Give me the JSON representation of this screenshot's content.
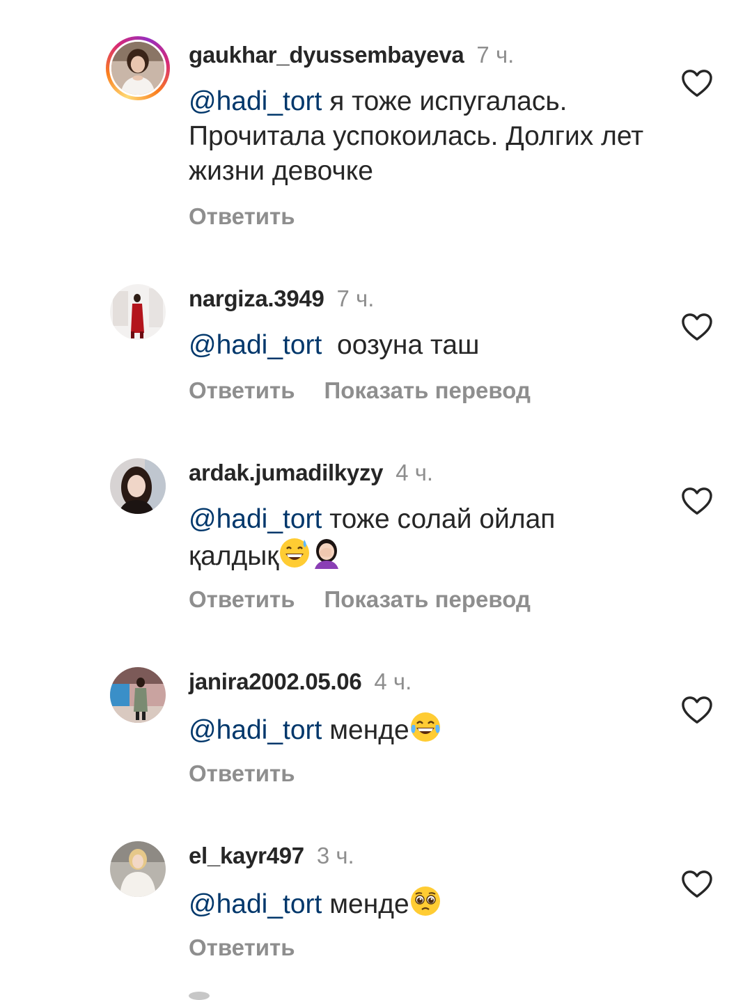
{
  "comments": [
    {
      "username": "gaukhar_dyussembayeva",
      "time": "7 ч.",
      "mention": "@hadi_tort",
      "text": " я тоже испугалась. Прочитала успокоилась. Долгих лет жизни девочке",
      "reply": "Ответить",
      "translate": "",
      "emojis": [],
      "has_story_ring": true
    },
    {
      "username": "nargiza.3949",
      "time": "7 ч.",
      "mention": "@hadi_tort",
      "text": "  оозуна таш",
      "reply": "Ответить",
      "translate": "Показать перевод",
      "emojis": [],
      "has_story_ring": false
    },
    {
      "username": "ardak.jumadilkyzy",
      "time": "4 ч.",
      "mention": "@hadi_tort",
      "text": " тоже солай ойлап қалдық",
      "reply": "Ответить",
      "translate": "Показать перевод",
      "emojis": [
        "grinning-sweat-emoji",
        "woman-facepalming-emoji"
      ],
      "has_story_ring": false
    },
    {
      "username": "janira2002.05.06",
      "time": "4 ч.",
      "mention": "@hadi_tort",
      "text": " менде",
      "reply": "Ответить",
      "translate": "",
      "emojis": [
        "tears-of-joy-emoji"
      ],
      "has_story_ring": false
    },
    {
      "username": "el_kayr497",
      "time": "3 ч.",
      "mention": "@hadi_tort",
      "text": " менде",
      "reply": "Ответить",
      "translate": "",
      "emojis": [
        "pleading-face-emoji"
      ],
      "has_story_ring": false
    }
  ],
  "colors": {
    "mention": "#00376b",
    "secondary_text": "#8e8e8e",
    "primary_text": "#262626"
  }
}
